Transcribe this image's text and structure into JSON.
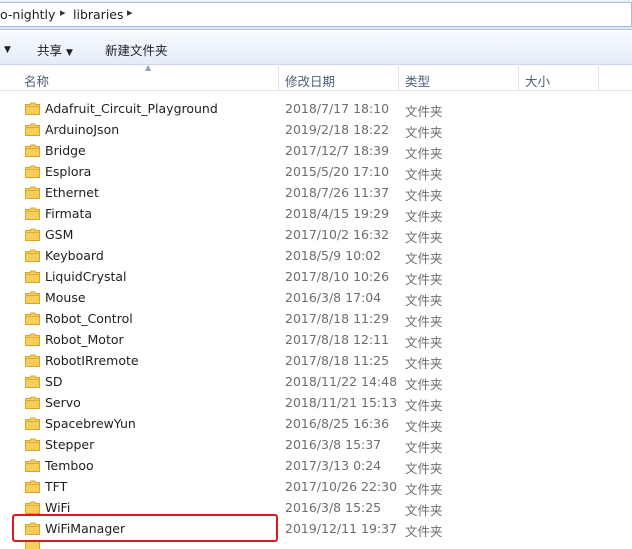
{
  "addressbar": {
    "crumbs": [
      "o-nightly",
      "libraries"
    ]
  },
  "toolbar": {
    "share_label": "共享",
    "new_folder_label": "新建文件夹"
  },
  "columns": {
    "name": "名称",
    "date": "修改日期",
    "type": "类型",
    "size": "大小"
  },
  "files": [
    {
      "name": "Adafruit_Circuit_Playground",
      "date": "2018/7/17 18:10",
      "type": "文件夹"
    },
    {
      "name": "ArduinoJson",
      "date": "2019/2/18 18:22",
      "type": "文件夹"
    },
    {
      "name": "Bridge",
      "date": "2017/12/7 18:39",
      "type": "文件夹"
    },
    {
      "name": "Esplora",
      "date": "2015/5/20 17:10",
      "type": "文件夹"
    },
    {
      "name": "Ethernet",
      "date": "2018/7/26 11:37",
      "type": "文件夹"
    },
    {
      "name": "Firmata",
      "date": "2018/4/15 19:29",
      "type": "文件夹"
    },
    {
      "name": "GSM",
      "date": "2017/10/2 16:32",
      "type": "文件夹"
    },
    {
      "name": "Keyboard",
      "date": "2018/5/9 10:02",
      "type": "文件夹"
    },
    {
      "name": "LiquidCrystal",
      "date": "2017/8/10 10:26",
      "type": "文件夹"
    },
    {
      "name": "Mouse",
      "date": "2016/3/8 17:04",
      "type": "文件夹"
    },
    {
      "name": "Robot_Control",
      "date": "2017/8/18 11:29",
      "type": "文件夹"
    },
    {
      "name": "Robot_Motor",
      "date": "2017/8/18 12:11",
      "type": "文件夹"
    },
    {
      "name": "RobotIRremote",
      "date": "2017/8/18 11:25",
      "type": "文件夹"
    },
    {
      "name": "SD",
      "date": "2018/11/22 14:48",
      "type": "文件夹"
    },
    {
      "name": "Servo",
      "date": "2018/11/21 15:13",
      "type": "文件夹"
    },
    {
      "name": "SpacebrewYun",
      "date": "2016/8/25 16:36",
      "type": "文件夹"
    },
    {
      "name": "Stepper",
      "date": "2016/3/8 15:37",
      "type": "文件夹"
    },
    {
      "name": "Temboo",
      "date": "2017/3/13 0:24",
      "type": "文件夹"
    },
    {
      "name": "TFT",
      "date": "2017/10/26 22:30",
      "type": "文件夹"
    },
    {
      "name": "WiFi",
      "date": "2016/3/8 15:25",
      "type": "文件夹"
    },
    {
      "name": "WiFiManager",
      "date": "2019/12/11 19:37",
      "type": "文件夹",
      "highlighted": true
    }
  ],
  "colors": {
    "highlight_border": "#e0191e",
    "folder_fill": "#f5cf5c",
    "folder_dark": "#d9a429"
  },
  "icons": {
    "folder": "folder-icon",
    "share_dropdown": "chevron-down-icon",
    "sort": "sort-ascending-icon"
  }
}
